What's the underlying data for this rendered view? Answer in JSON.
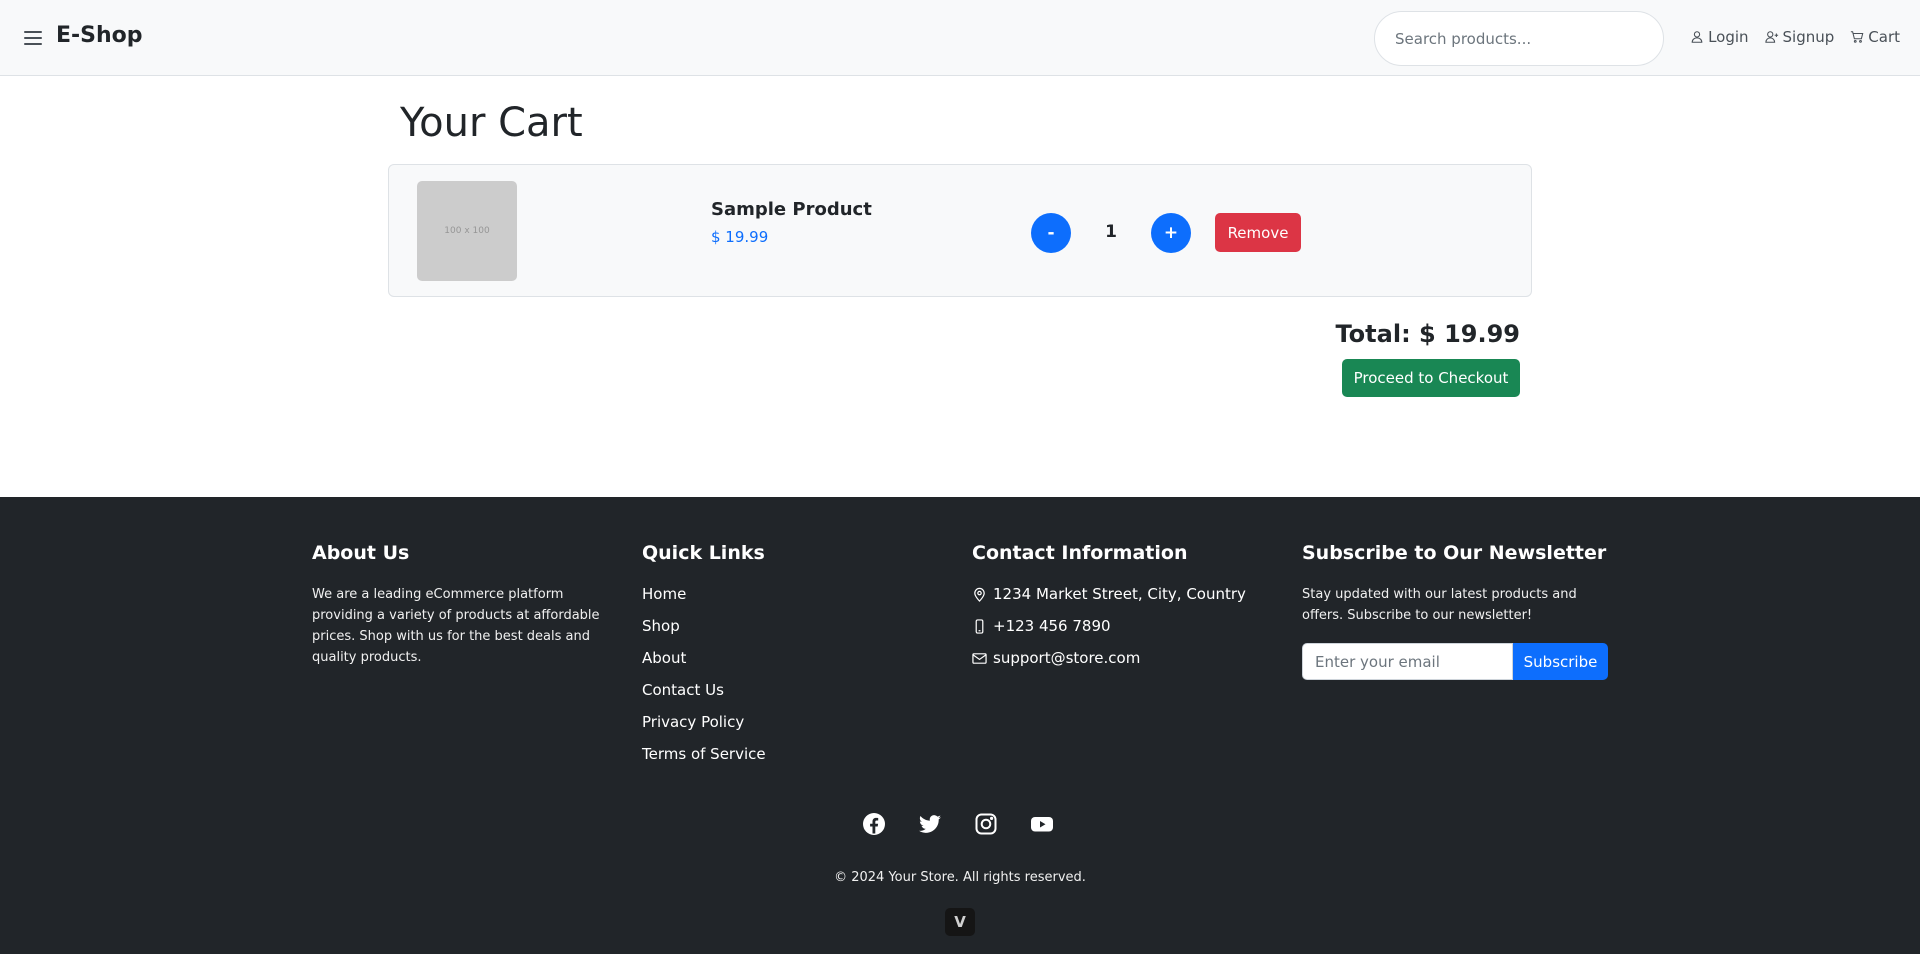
{
  "header": {
    "brand": "E-Shop",
    "search_placeholder": "Search products...",
    "nav": [
      {
        "label": "Login",
        "icon": "person-icon"
      },
      {
        "label": "Signup",
        "icon": "person-add-icon"
      },
      {
        "label": "Cart",
        "icon": "cart-icon"
      }
    ]
  },
  "cart": {
    "title": "Your Cart",
    "items": [
      {
        "image_label": "100 x 100",
        "name": "Sample Product",
        "price": "$ 19.99",
        "quantity": "1",
        "decrement_label": "-",
        "increment_label": "+",
        "remove_label": "Remove"
      }
    ],
    "total": "Total: $ 19.99",
    "checkout_label": "Proceed to Checkout"
  },
  "footer": {
    "about": {
      "title": "About Us",
      "text": "We are a leading eCommerce platform providing a variety of products at affordable prices. Shop with us for the best deals and quality products."
    },
    "quick_links": {
      "title": "Quick Links",
      "items": [
        "Home",
        "Shop",
        "About",
        "Contact Us",
        "Privacy Policy",
        "Terms of Service"
      ]
    },
    "contact": {
      "title": "Contact Information",
      "address": "1234 Market Street, City, Country",
      "phone": "+123 456 7890",
      "email": "support@store.com"
    },
    "newsletter": {
      "title": "Subscribe to Our Newsletter",
      "text": "Stay updated with our latest products and offers. Subscribe to our newsletter!",
      "placeholder": "Enter your email",
      "button": "Subscribe"
    },
    "socials": [
      "facebook-icon",
      "twitter-icon",
      "instagram-icon",
      "youtube-icon"
    ],
    "copyright": "© 2024 Your Store. All rights reserved.",
    "badge": "V"
  },
  "colors": {
    "primary": "#0d6efd",
    "danger": "#dc3545",
    "success": "#198754",
    "footer_bg": "#212529"
  }
}
